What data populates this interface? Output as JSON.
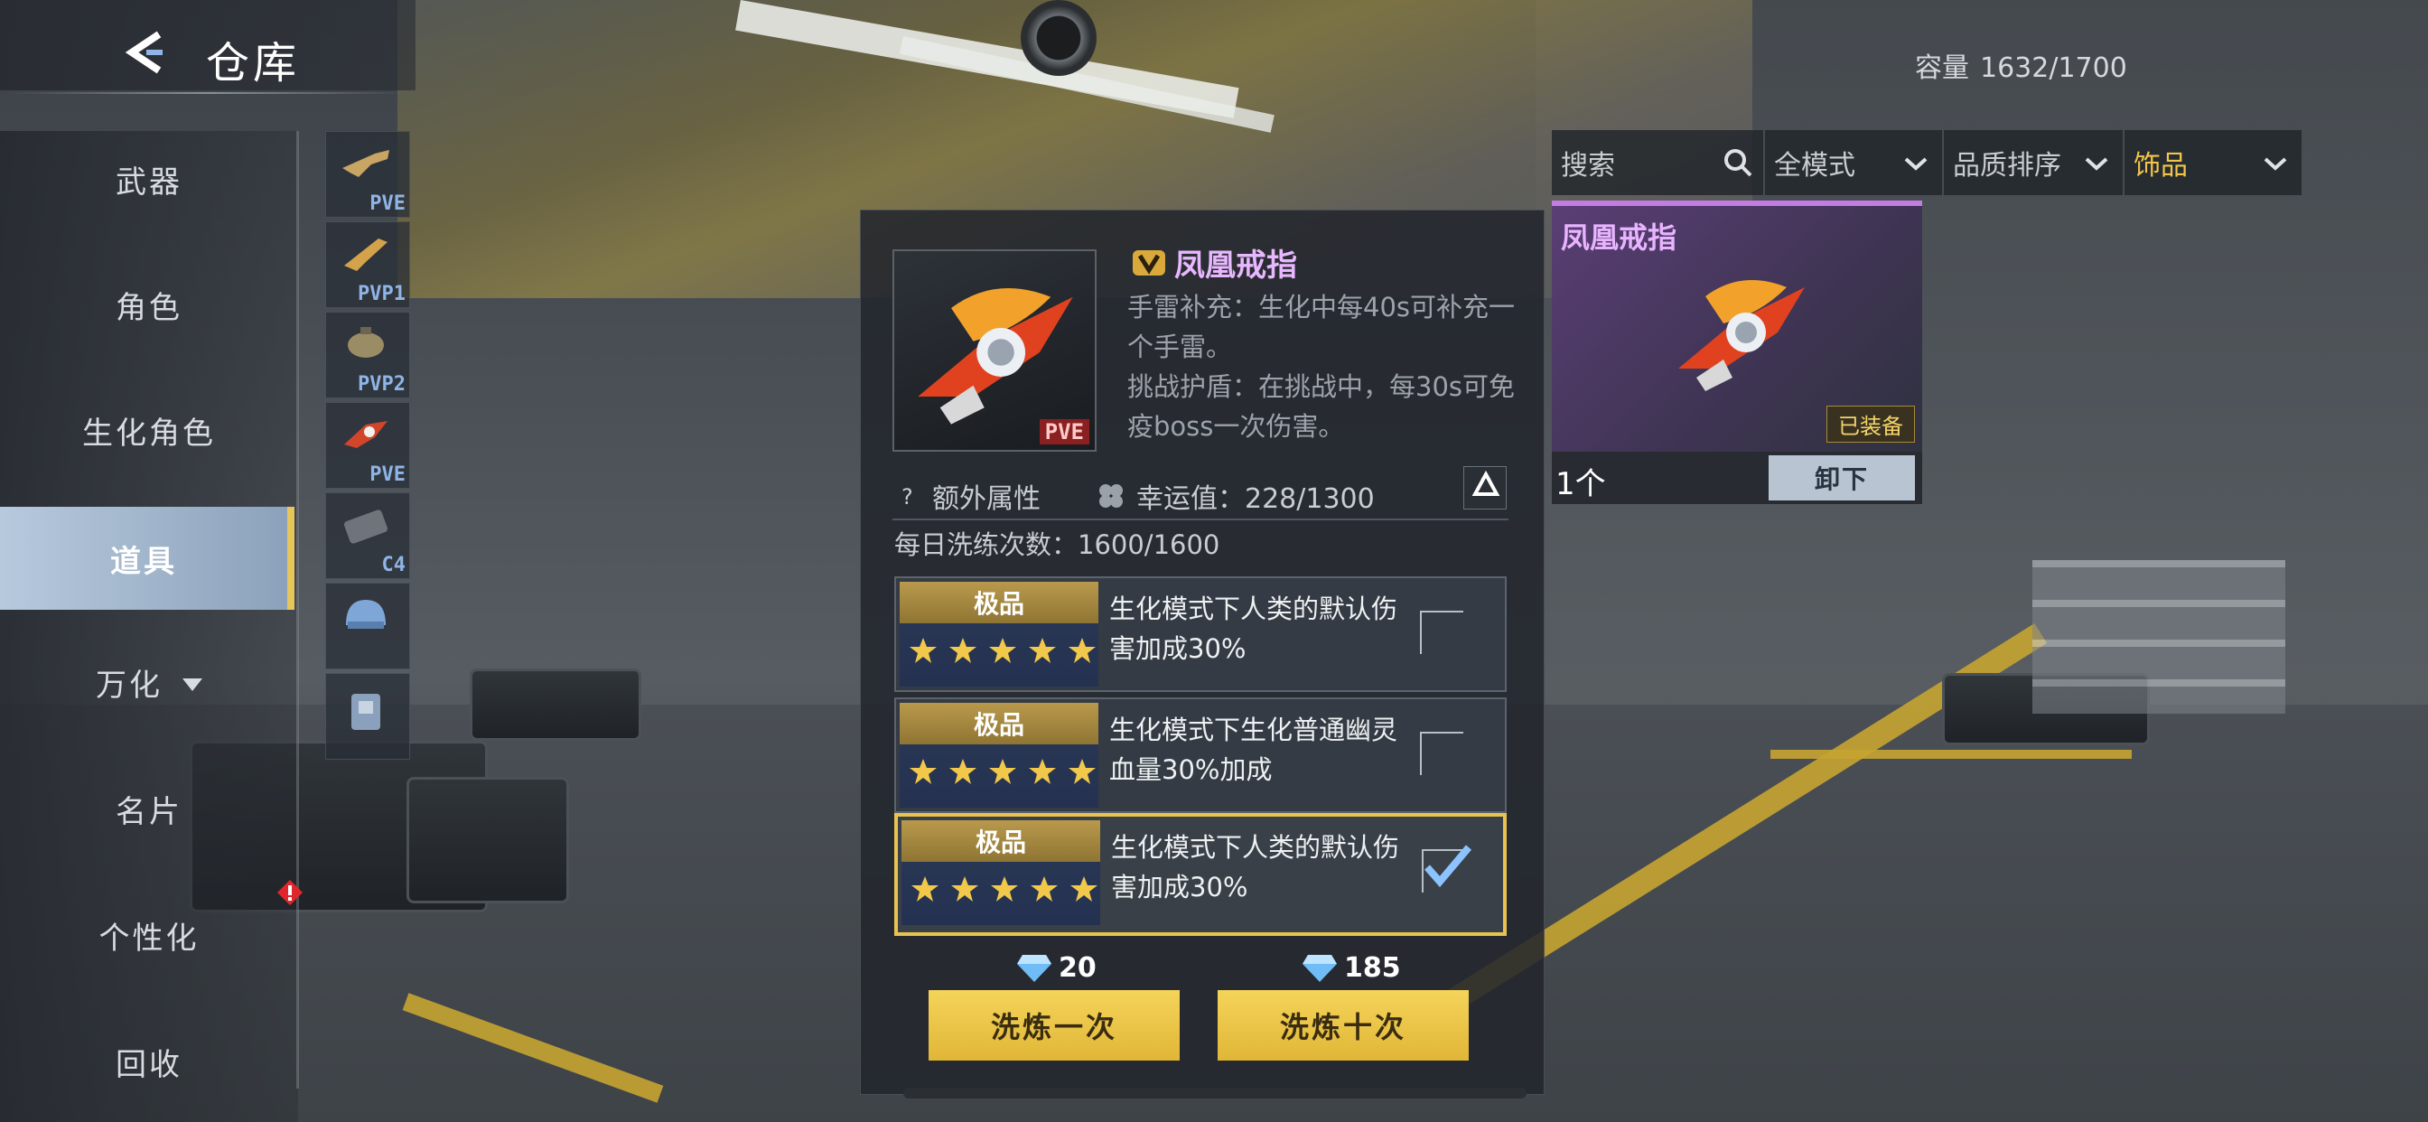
{
  "app": {
    "title": "仓库",
    "capacity_label": "容量",
    "capacity_value": "1632/1700"
  },
  "nav": {
    "items": [
      {
        "label": "武器"
      },
      {
        "label": "角色"
      },
      {
        "label": "生化角色"
      },
      {
        "label": "道具",
        "active": true
      },
      {
        "label": "万化",
        "has_dropdown": true
      },
      {
        "label": "名片"
      },
      {
        "label": "个性化",
        "has_alert": true
      },
      {
        "label": "回收"
      }
    ]
  },
  "sub_items": [
    {
      "tag": "PVE",
      "icon": "gun-icon"
    },
    {
      "tag": "PVP1",
      "icon": "gun-icon"
    },
    {
      "tag": "PVP2",
      "icon": "grenade-icon"
    },
    {
      "tag": "PVE",
      "icon": "ring-icon"
    },
    {
      "tag": "C4",
      "icon": "c4-icon"
    },
    {
      "tag": "",
      "icon": "helmet-icon"
    },
    {
      "tag": "",
      "icon": "vest-icon"
    }
  ],
  "filters": {
    "search_placeholder": "搜索",
    "mode": "全模式",
    "sort": "品质排序",
    "category": "饰品"
  },
  "card": {
    "name": "凤凰戒指",
    "equipped": "已装备",
    "count": "1个",
    "unequip": "卸下"
  },
  "detail": {
    "name": "凤凰戒指",
    "tag": "PVE",
    "desc1": "手雷补充：生化中每40s可补充一个手雷。",
    "desc2": "挑战护盾：在挑战中，每30s可免疫boss一次伤害。",
    "extra_label": "额外属性",
    "luck_label": "幸运值：228/1300",
    "daily": "每日洗练次数：1600/1600"
  },
  "options": [
    {
      "quality": "极品",
      "stars": 5,
      "text": "生化模式下人类的默认伤害加成30%",
      "checked": false
    },
    {
      "quality": "极品",
      "stars": 5,
      "text": "生化模式下生化普通幽灵血量30%加成",
      "checked": false
    },
    {
      "quality": "极品",
      "stars": 5,
      "text": "生化模式下人类的默认伤害加成30%",
      "checked": true
    }
  ],
  "actions": {
    "once_cost": "20",
    "once_label": "洗炼一次",
    "ten_cost": "185",
    "ten_label": "洗炼十次"
  },
  "colors": {
    "accent": "#e9c34f",
    "purple": "#e7b7ff"
  }
}
